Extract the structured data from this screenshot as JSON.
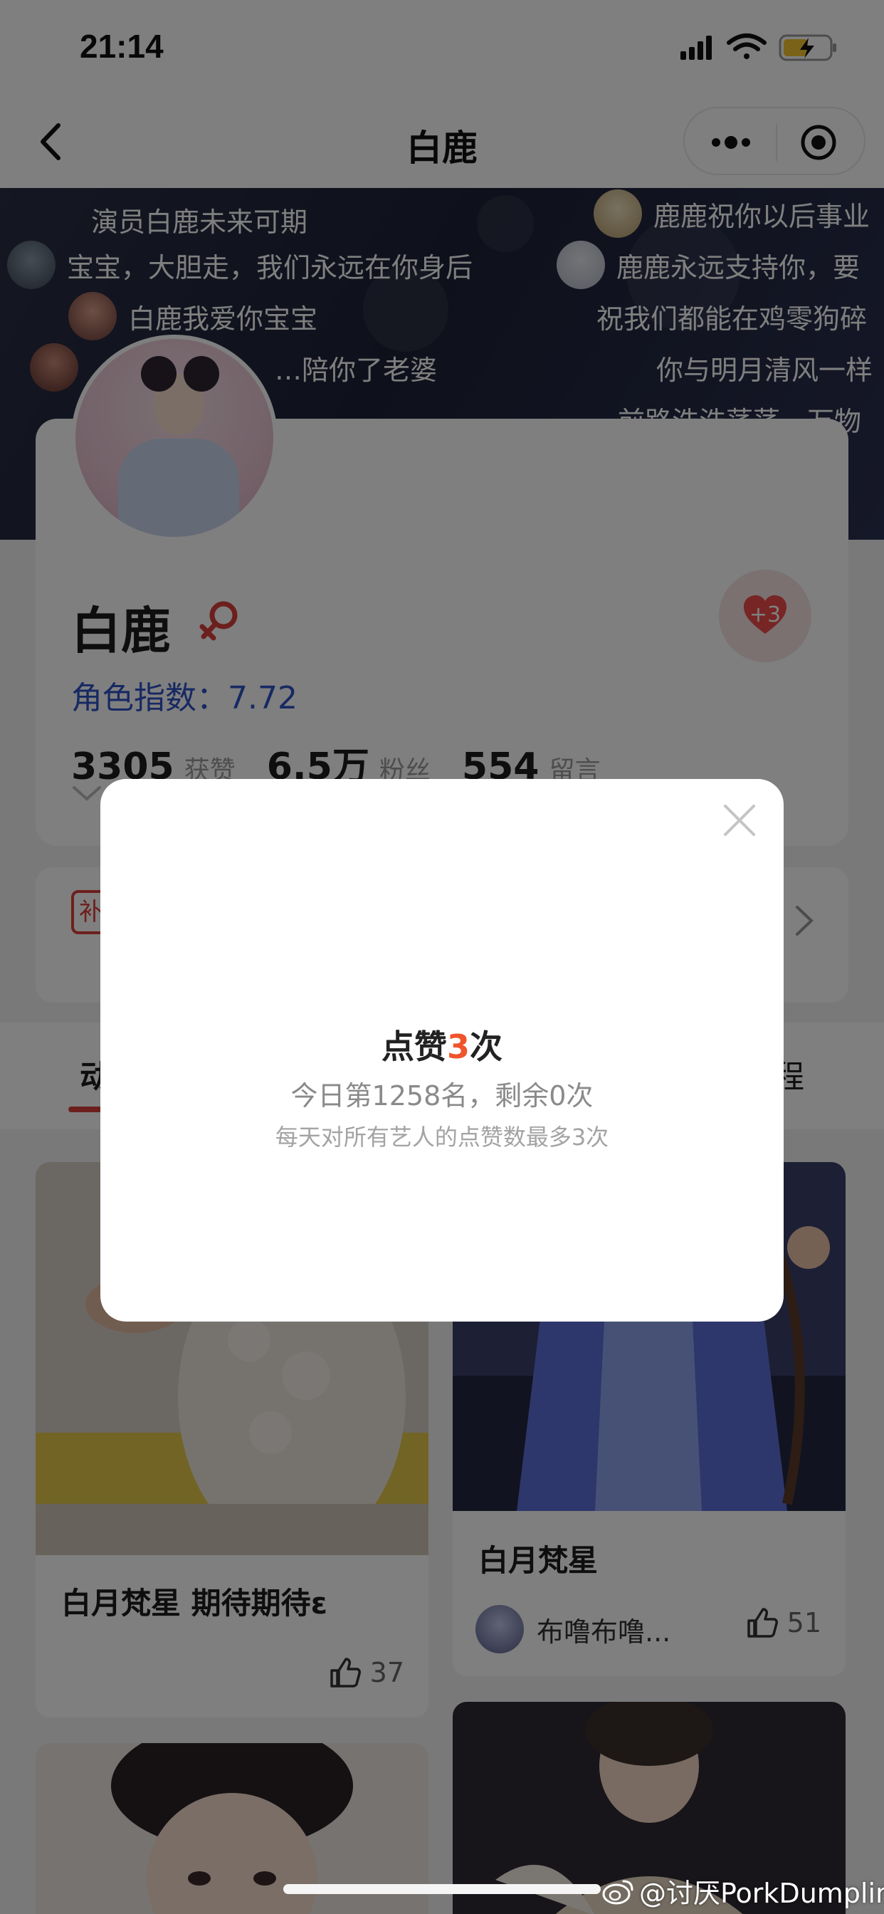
{
  "status_bar": {
    "time": "21:14"
  },
  "nav": {
    "title": "白鹿"
  },
  "danmaku": [
    {
      "text": "演员白鹿未来可期",
      "has_avatar": false
    },
    {
      "text": "鹿鹿祝你以后事业",
      "has_avatar": true
    },
    {
      "text": "宝宝，大胆走，我们永远在你身后",
      "has_avatar": true
    },
    {
      "text": "鹿鹿永远支持你，要",
      "has_avatar": true
    },
    {
      "text": "白鹿我爱你宝宝",
      "has_avatar": true
    },
    {
      "text": "祝我们都能在鸡零狗碎",
      "has_avatar": false
    },
    {
      "text": "…陪你了老婆",
      "has_avatar": true
    },
    {
      "text": "你与明月清风一样",
      "has_avatar": false
    },
    {
      "text": "前路浩浩荡荡，万物",
      "has_avatar": false
    }
  ],
  "profile": {
    "name": "白鹿",
    "gender_icon": "female-icon",
    "index_label": "角色指数：",
    "index_value": "7.72",
    "heart_count": "+3",
    "stats": [
      {
        "value": "3305",
        "label": "获赞"
      },
      {
        "value": "6.5万",
        "label": "粉丝"
      },
      {
        "value": "554",
        "label": "留言"
      }
    ]
  },
  "section2": {
    "tag": "补"
  },
  "tabs": {
    "left": "动",
    "right": "程"
  },
  "feed": [
    {
      "title": "白月梵星 期待期待ε",
      "likes": "37"
    },
    {
      "title": "白月梵星",
      "author": "布噜布噜...",
      "likes": "51"
    }
  ],
  "modal": {
    "title_prefix": "点赞",
    "title_count": "3",
    "title_suffix": "次",
    "rank_text": "今日第1258名，剩余0次",
    "note": "每天对所有艺人的点赞数最多3次"
  },
  "watermark": "@讨厌PorkDumplings",
  "colors": {
    "accent_red": "#d9403a",
    "count_orange": "#f0542c",
    "index_blue": "#2f52c6"
  }
}
